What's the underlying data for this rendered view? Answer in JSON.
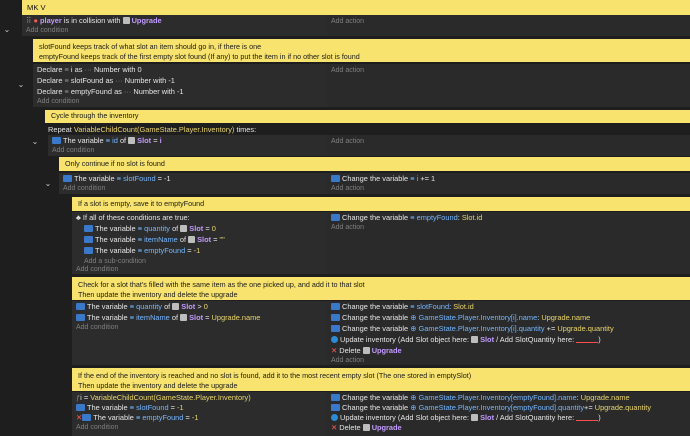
{
  "header": {
    "title": "MK V"
  },
  "ev1": {
    "cond": {
      "object": "player",
      "text": "is in collision with",
      "target": "Upgrade"
    },
    "add_action": "Add action",
    "add_condition": "Add condition"
  },
  "comment1": {
    "line1": "slotFound keeps track of what slot an item should go in, if there is one",
    "line2": "emptyFound keeps track of the first empty slot found (If any) to put the item in if no other slot is found"
  },
  "declares": [
    {
      "pre": "Declare",
      "name": "i",
      "as": "as",
      "type": "Number",
      "with": "with",
      "val": "0"
    },
    {
      "pre": "Declare",
      "name": "slotFound",
      "as": "as",
      "type": "Number",
      "with": "with",
      "val": "-1"
    },
    {
      "pre": "Declare",
      "name": "emptyFound",
      "as": "as",
      "type": "Number",
      "with": "with",
      "val": "-1"
    }
  ],
  "comment2": "Cycle through the inventory",
  "repeat": {
    "label": "Repeat",
    "expr": "VariableChildCount(GameState.Player.Inventory)",
    "suffix": "times:"
  },
  "ev_slot": {
    "a": "The variable",
    "name": "id",
    "of": "of",
    "obj": "Slot",
    "op": "=",
    "val": "i"
  },
  "comment3": "Only continue if no slot is found",
  "ev_nf": {
    "a": "The variable",
    "name": "slotFound",
    "op": "=",
    "val": "-1",
    "action": {
      "a": "Change the variable",
      "name": "i",
      "op": "+=",
      "val": "1"
    }
  },
  "comment4": "If a slot is empty, save it to emptyFound",
  "ev_empty": {
    "all": "If all of these conditions are true:",
    "c1": {
      "a": "The variable",
      "name": "quantity",
      "of": "of",
      "obj": "Slot",
      "op": "=",
      "val": "0"
    },
    "c2": {
      "a": "The variable",
      "name": "itemName",
      "of": "of",
      "obj": "Slot",
      "op": "=",
      "val": "\"\""
    },
    "c3": {
      "a": "The variable",
      "name": "emptyFound",
      "op": "=",
      "val": "-1"
    },
    "add_sub": "Add a sub-condition",
    "action": {
      "a": "Change the variable",
      "name": "emptyFound",
      "op": ":",
      "val": "Slot.id"
    }
  },
  "comment5": {
    "line1": "Check for a slot that's filled with the same item as the one picked up, and add it to that slot",
    "line2": "Then update the inventory and delete the upgrade"
  },
  "ev_same": {
    "c1": {
      "a": "The variable",
      "name": "quantity",
      "of": "of",
      "obj": "Slot",
      "op": ">",
      "val": "0"
    },
    "c2": {
      "a": "The variable",
      "name": "itemName",
      "of": "of",
      "obj": "Slot",
      "op": "=",
      "val": "Upgrade.name"
    },
    "a1": {
      "a": "Change the variable",
      "name": "slotFound",
      "op": ":",
      "val": "Slot.id"
    },
    "a2": {
      "a": "Change the variable",
      "name": "GameState.Player.Inventory[i].name",
      "op": ":",
      "val": "Upgrade.name"
    },
    "a3": {
      "a": "Change the variable",
      "name": "GameState.Player.Inventory[i].quantity",
      "op": "+=",
      "val": "Upgrade.quantity"
    },
    "a4": {
      "text": "Update inventory (Add Slot object here:",
      "obj": "Slot",
      "mid": "/ Add SlotQuantity here:",
      "end": ")"
    },
    "a5": {
      "pre": "Delete",
      "obj": "Upgrade"
    }
  },
  "comment6": {
    "line1": "If the end of the inventory is reached and no slot is found, add it to the most recent empty slot (The one stored in emptySlot)",
    "line2": "Then update the inventory and delete the upgrade"
  },
  "ev_last": {
    "c1": {
      "name": "i",
      "op": "=",
      "val": "VariableChildCount(GameState.Player.Inventory)"
    },
    "c2": {
      "a": "The variable",
      "name": "slotFound",
      "op": "=",
      "val": "-1"
    },
    "c3": {
      "a": "The variable",
      "name": "emptyFound",
      "op": "=",
      "val": "-1"
    },
    "a1": {
      "a": "Change the variable",
      "name": "GameState.Player.Inventory[emptyFound].name",
      "op": ":",
      "val": "Upgrade.name"
    },
    "a2": {
      "a": "Change the variable",
      "name": "GameState.Player.Inventory[emptyFound].quantity",
      "op": "+=",
      "val": "Upgrade.quantity"
    },
    "a3": {
      "text": "Update inventory (Add Slot object here:",
      "obj": "Slot",
      "mid": "/ Add SlotQuantity here:",
      "end": ")"
    },
    "a4": {
      "pre": "Delete",
      "obj": "Upgrade"
    }
  },
  "labels": {
    "add_condition": "Add condition",
    "add_action": "Add action",
    "number": "Number"
  }
}
